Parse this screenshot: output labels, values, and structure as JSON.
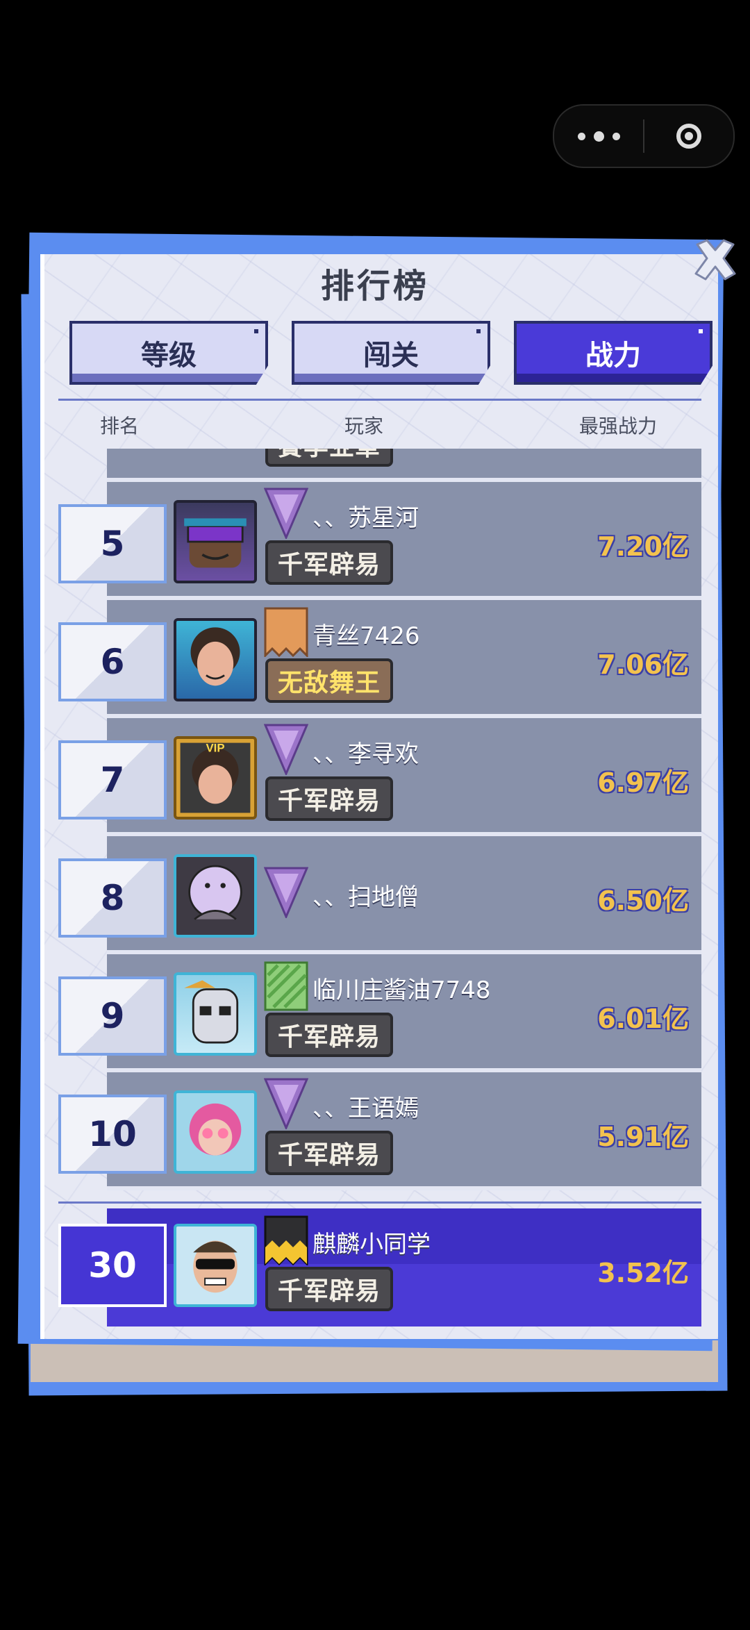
{
  "capsule": {
    "more_icon": "more-dots-icon",
    "close_icon": "target-close-icon"
  },
  "leaderboard": {
    "title": "排行榜",
    "tabs": [
      {
        "label": "等级",
        "active": false
      },
      {
        "label": "闯关",
        "active": false
      },
      {
        "label": "战力",
        "active": true
      }
    ],
    "columns": {
      "rank": "排名",
      "player": "玩家",
      "power": "最强战力"
    },
    "partial_row_title": "賽李业軍",
    "rows": [
      {
        "rank": "5",
        "name": "、、苏星河",
        "title": "千军辟易",
        "power": "7.20亿",
        "badge": "purple-triangle"
      },
      {
        "rank": "6",
        "name": "青丝7426",
        "title": "无敌舞王",
        "power": "7.06亿",
        "badge": "orange-flag"
      },
      {
        "rank": "7",
        "name": "、、李寻欢",
        "title": "千军辟易",
        "power": "6.97亿",
        "badge": "purple-triangle"
      },
      {
        "rank": "8",
        "name": "、、扫地僧",
        "title": "",
        "power": "6.50亿",
        "badge": "purple-triangle"
      },
      {
        "rank": "9",
        "name": "临川庄酱油7748",
        "title": "千军辟易",
        "power": "6.01亿",
        "badge": "green-flag"
      },
      {
        "rank": "10",
        "name": "、、王语嫣",
        "title": "千军辟易",
        "power": "5.91亿",
        "badge": "purple-triangle"
      }
    ],
    "me": {
      "rank": "30",
      "name": "麒麟小同学",
      "title": "千军辟易",
      "power": "3.52亿",
      "badge": "black-yellow-flag"
    }
  },
  "colors": {
    "accent": "#4a3ad8",
    "power_gold": "#f2c24f",
    "panel_blue": "#5b8df0"
  }
}
